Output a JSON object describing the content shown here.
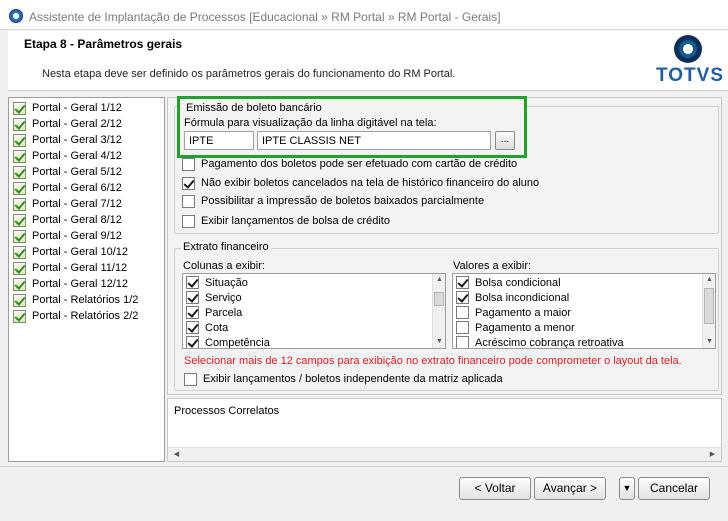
{
  "window": {
    "title": "Assistente de Implantação de Processos [Educacional » RM Portal » RM Portal - Gerais]"
  },
  "header": {
    "step_title": "Etapa 8 - Parâmetros gerais",
    "description": "Nesta etapa deve ser definido os parâmetros gerais do funcionamento do RM Portal.",
    "logo_text": "TOTVS"
  },
  "steps": [
    "Portal - Geral 1/12",
    "Portal - Geral 2/12",
    "Portal - Geral 3/12",
    "Portal - Geral 4/12",
    "Portal - Geral 5/12",
    "Portal - Geral 6/12",
    "Portal - Geral 7/12",
    "Portal - Geral 8/12",
    "Portal - Geral 9/12",
    "Portal - Geral 10/12",
    "Portal - Geral 11/12",
    "Portal - Geral 12/12",
    "Portal - Relatórios 1/2",
    "Portal - Relatórios 2/2"
  ],
  "boleto": {
    "group_title": "Emissão de boleto bancário",
    "formula_label": "Fórmula para visualização da linha digitável na tela:",
    "formula_code": "IPTE",
    "formula_name": "IPTE CLASSIS NET",
    "browse_label": "...",
    "options": [
      {
        "label": "Pagamento dos boletos pode ser efetuado com cartão de crédito",
        "checked": false
      },
      {
        "label": "Não exibir boletos cancelados na tela de histórico financeiro do aluno",
        "checked": true
      },
      {
        "label": "Possibilitar a impressão de boletos baixados parcialmente",
        "checked": false
      },
      {
        "label": "Exibir lançamentos de bolsa de crédito",
        "checked": false
      }
    ]
  },
  "extrato": {
    "group_title": "Extrato financeiro",
    "columns_label": "Colunas a exibir:",
    "columns": [
      {
        "label": "Situação",
        "checked": true
      },
      {
        "label": "Serviço",
        "checked": true
      },
      {
        "label": "Parcela",
        "checked": true
      },
      {
        "label": "Cota",
        "checked": true
      },
      {
        "label": "Competência",
        "checked": true
      }
    ],
    "values_label": "Valores a exibir:",
    "values": [
      {
        "label": "Bolsa condicional",
        "checked": true
      },
      {
        "label": "Bolsa incondicional",
        "checked": true
      },
      {
        "label": "Pagamento a maior",
        "checked": false
      },
      {
        "label": "Pagamento a menor",
        "checked": false
      },
      {
        "label": "Acréscimo cobrança retroativa",
        "checked": false
      }
    ],
    "warning": "Selecionar mais de 12 campos para exibição no extrato financeiro pode comprometer o layout da tela.",
    "independent_label": "Exibir lançamentos / boletos independente da matriz aplicada"
  },
  "related": {
    "title": "Processos Correlatos"
  },
  "buttons": {
    "back": "< Voltar",
    "next": "Avançar >",
    "cancel": "Cancelar"
  }
}
